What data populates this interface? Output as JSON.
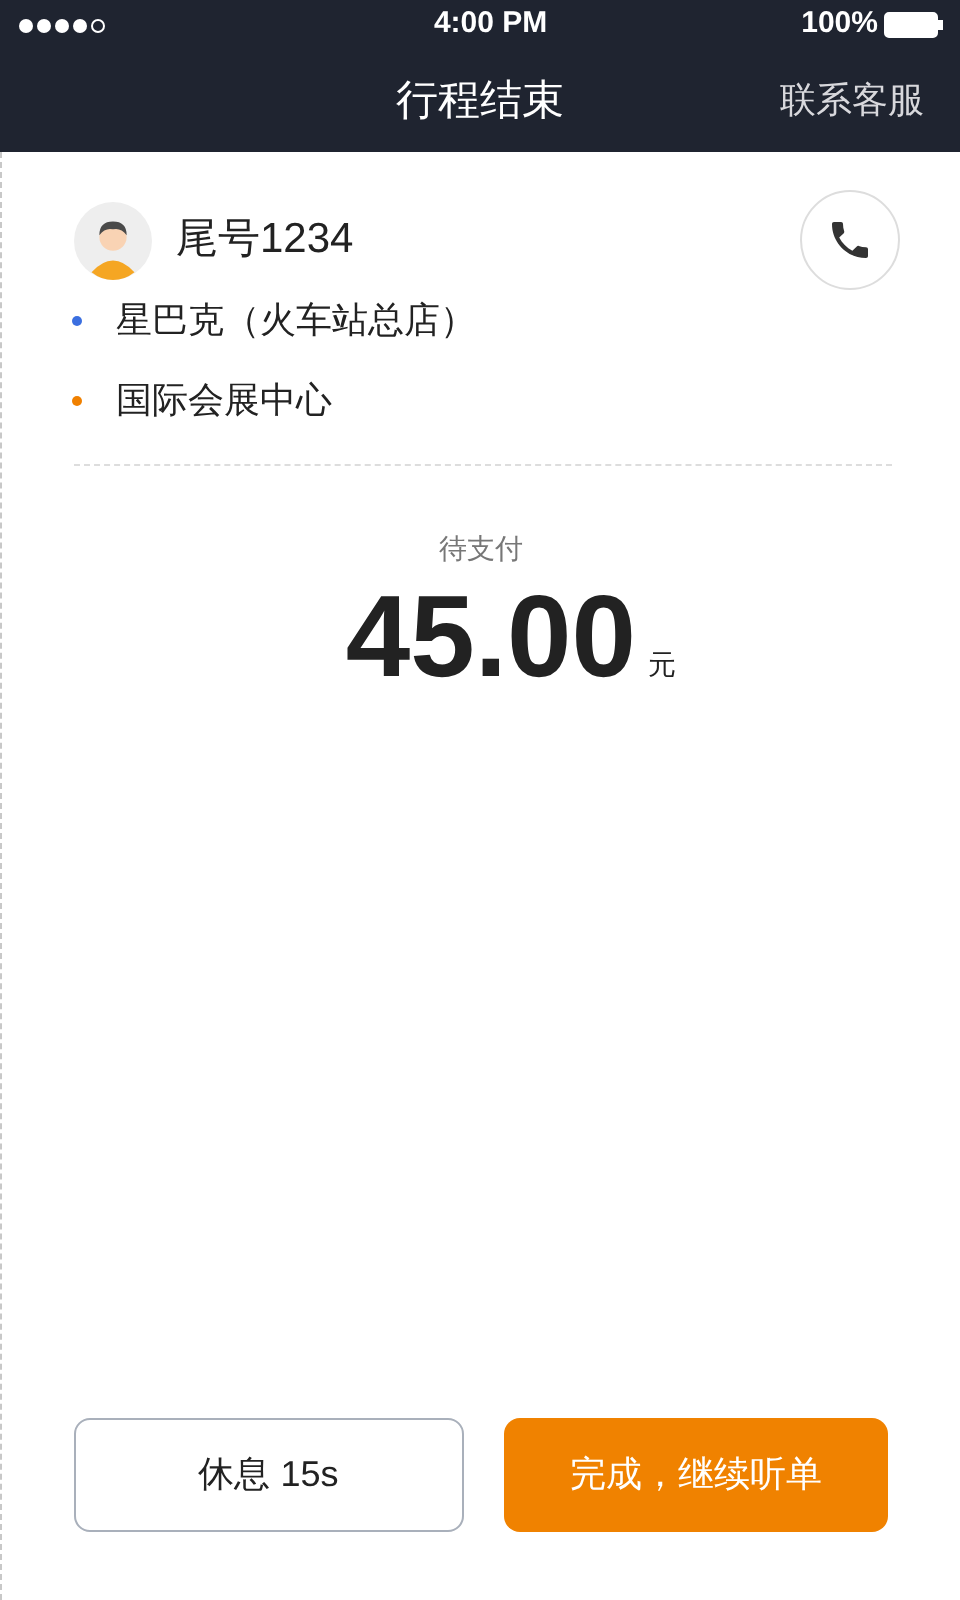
{
  "status_bar": {
    "time": "4:00 PM",
    "battery": "100%"
  },
  "nav": {
    "title": "行程结束",
    "action": "联系客服"
  },
  "passenger": {
    "name": "尾号1234"
  },
  "stops": [
    {
      "name": "星巴克（火车站总店）",
      "color": "#3b6fe0"
    },
    {
      "name": "国际会展中心",
      "color": "#f08000"
    }
  ],
  "fare": {
    "label": "待支付",
    "amount": "45.00",
    "unit": "元"
  },
  "buttons": [
    {
      "label": "休息 15s",
      "kind": "outline"
    },
    {
      "label": "完成，继续听单",
      "kind": "primary"
    }
  ]
}
